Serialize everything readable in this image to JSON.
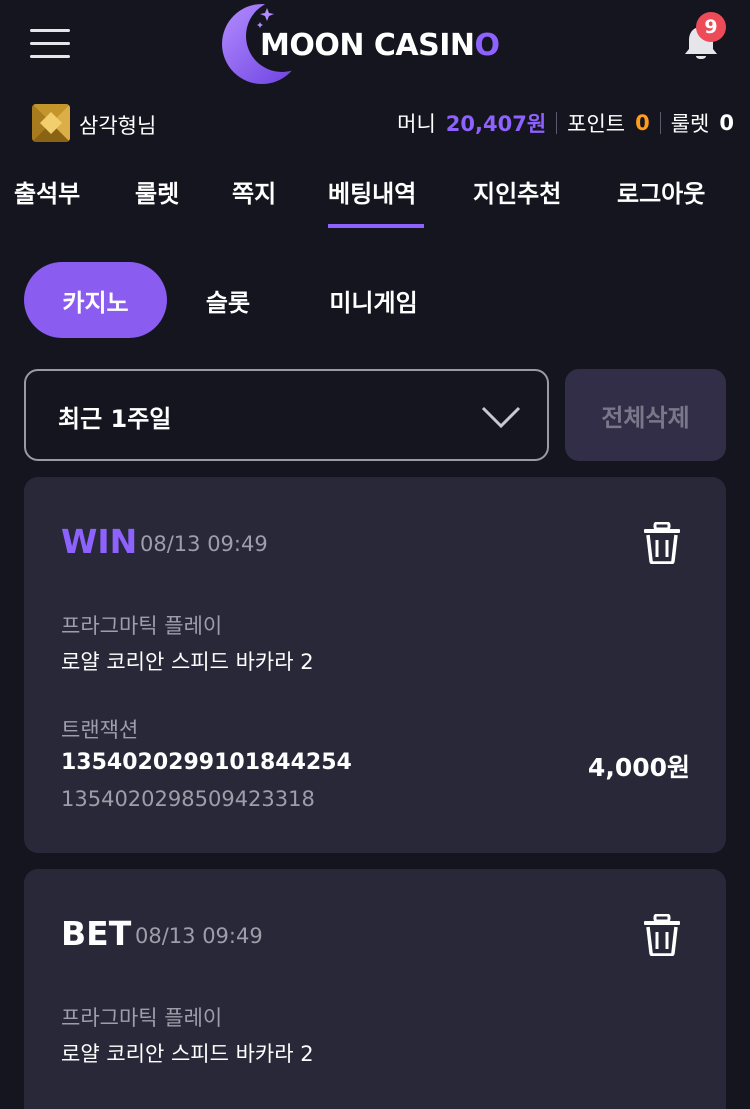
{
  "header": {
    "logo": {
      "word1": "MOON CASIN",
      "word2": "O"
    },
    "notification_count": "9"
  },
  "user": {
    "name": "삼각형님",
    "money_label": "머니",
    "money_value": "20,407원",
    "point_label": "포인트",
    "point_value": "0",
    "roulette_label": "룰렛",
    "roulette_value": "0"
  },
  "nav": {
    "items": [
      {
        "label": "출석부"
      },
      {
        "label": "룰렛"
      },
      {
        "label": "쪽지"
      },
      {
        "label": "베팅내역",
        "active": true
      },
      {
        "label": "지인추천"
      },
      {
        "label": "로그아웃"
      }
    ]
  },
  "tabs": [
    {
      "label": "카지노",
      "active": true
    },
    {
      "label": "슬롯"
    },
    {
      "label": "미니게임"
    }
  ],
  "filter": {
    "selected": "최근 1주일",
    "delete_all_label": "전체삭제"
  },
  "records": [
    {
      "status": "WIN",
      "time": "08/13 09:49",
      "provider": "프라그마틱 플레이",
      "game": "로얄 코리안 스피드 바카라 2",
      "tx_label": "트랜잭션",
      "tx_id": "1354020299101844254",
      "tx_sub": "1354020298509423318",
      "amount": "4,000원"
    },
    {
      "status": "BET",
      "time": "08/13 09:49",
      "provider": "프라그마틱 플레이",
      "game": "로얄 코리안 스피드 바카라 2"
    }
  ],
  "colors": {
    "background": "#15151f",
    "card": "#282838",
    "accent": "#8e62ff",
    "point": "#ff9d1c",
    "badge": "#ec4b57"
  }
}
